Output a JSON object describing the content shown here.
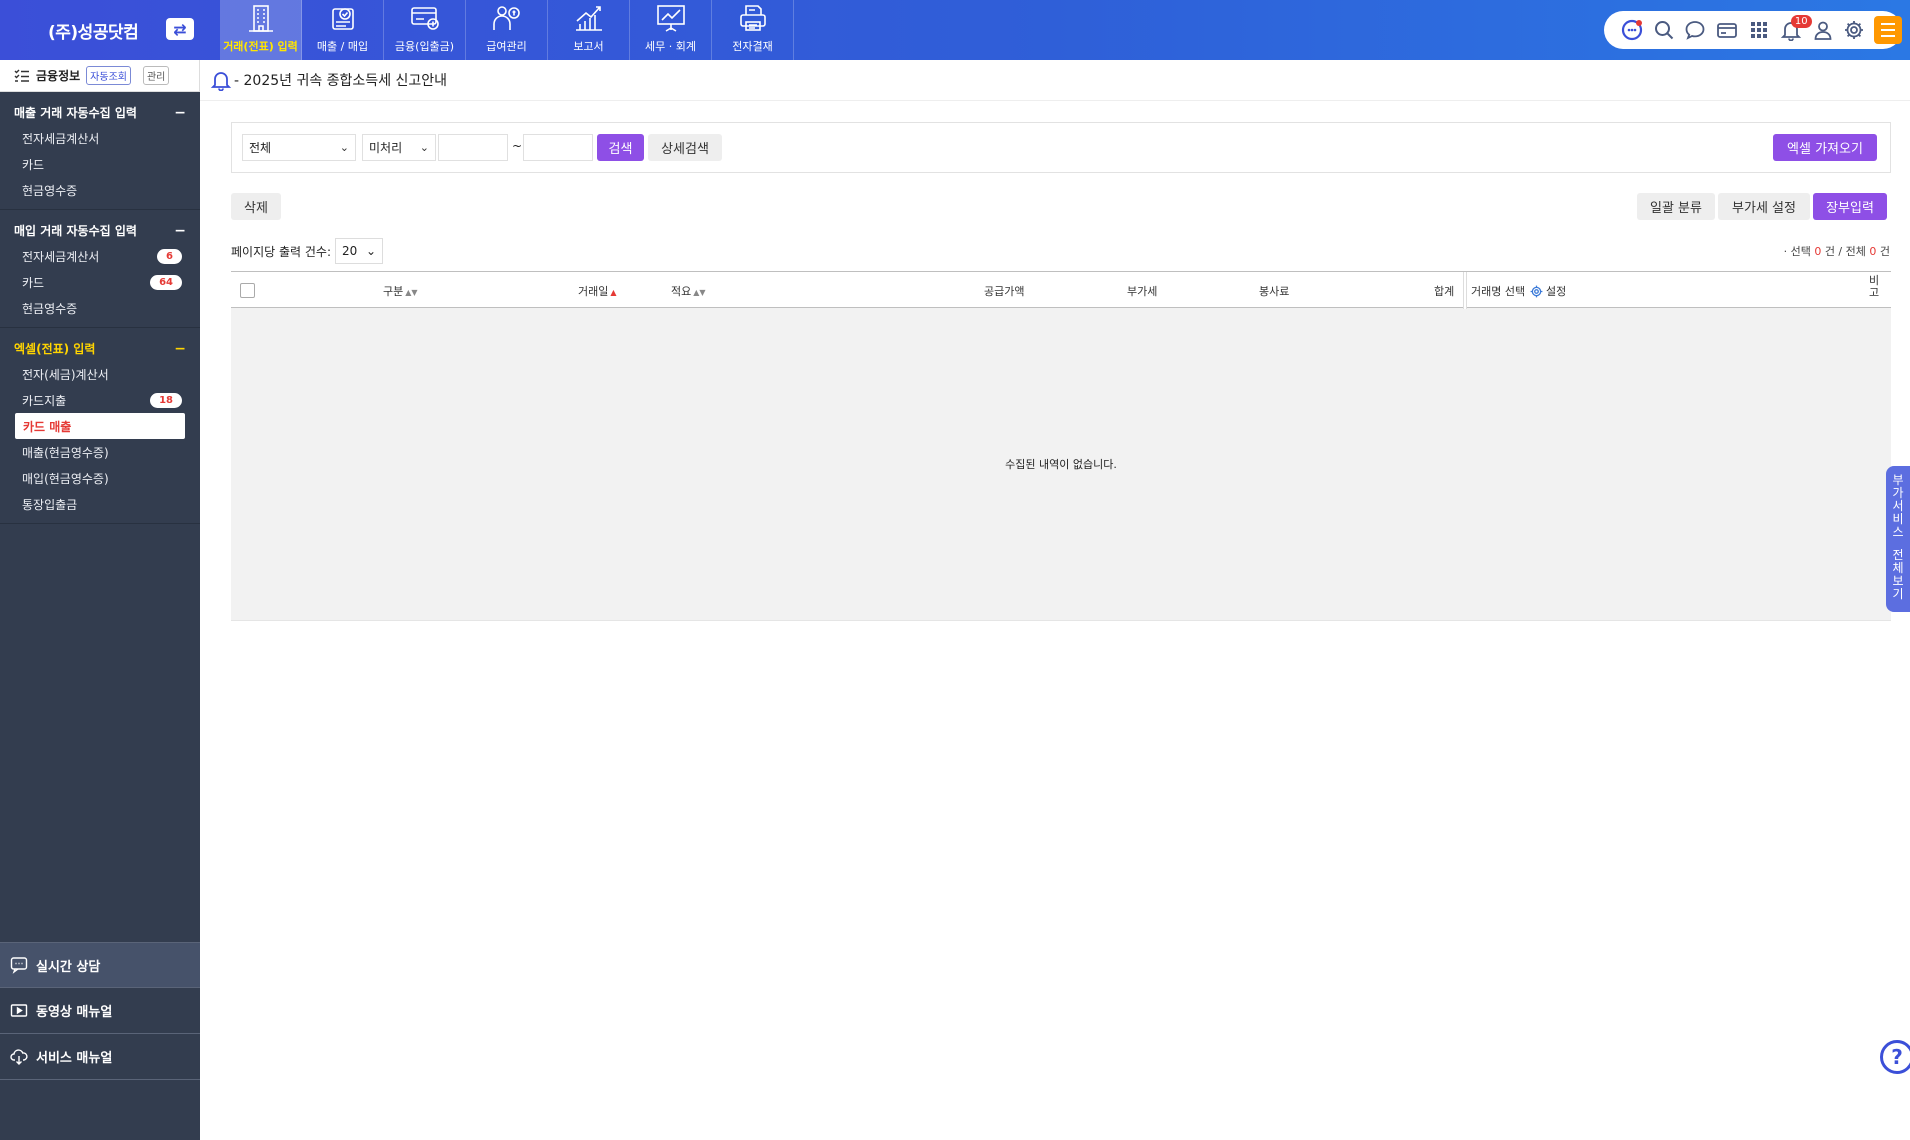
{
  "brand": {
    "name": "(주)성공닷컴",
    "switch_icon": "⇄"
  },
  "gnb": [
    {
      "label": "거래(전표) 입력",
      "icon": "building-icon",
      "active": true
    },
    {
      "label": "매출 / 매입",
      "icon": "receipt-check-icon"
    },
    {
      "label": "금융(입출금)",
      "icon": "card-coin-icon"
    },
    {
      "label": "급여관리",
      "icon": "payroll-icon"
    },
    {
      "label": "보고서",
      "icon": "chart-up-icon"
    },
    {
      "label": "세무 · 회계",
      "icon": "presentation-icon"
    },
    {
      "label": "전자결재",
      "icon": "printer-icon"
    }
  ],
  "tools": {
    "notification_count": "10"
  },
  "sidebar": {
    "head": {
      "title": "금융정보",
      "auto_chip": "자동조회",
      "manage_chip": "관리"
    },
    "groups": [
      {
        "title": "매출 거래 자동수집 입력",
        "items": [
          {
            "label": "전자세금계산서"
          },
          {
            "label": "카드"
          },
          {
            "label": "현금영수증"
          }
        ]
      },
      {
        "title": "매입 거래 자동수집 입력",
        "items": [
          {
            "label": "전자세금계산서",
            "badge": "6"
          },
          {
            "label": "카드",
            "badge": "64"
          },
          {
            "label": "현금영수증"
          }
        ]
      },
      {
        "title": "엑셀(전표) 입력",
        "items": [
          {
            "label": "전자(세금)계산서"
          },
          {
            "label": "카드지출",
            "badge": "18"
          },
          {
            "label": "카드 매출"
          },
          {
            "label": "매출(현금영수증)"
          },
          {
            "label": "매입(현금영수증)"
          },
          {
            "label": "통장입출금"
          }
        ]
      }
    ],
    "bottom": {
      "chat": "실시간 상담",
      "video": "동영상 매뉴얼",
      "service": "서비스 매뉴얼"
    }
  },
  "notice": {
    "text": "- 2025년 귀속 종합소득세 신고안내"
  },
  "search": {
    "type_value": "전체",
    "status_value": "미처리",
    "tilde": "~",
    "search_button": "검색",
    "detail_button": "상세검색",
    "excel_import_button": "엑셀 가져오기"
  },
  "actions": {
    "delete": "삭제",
    "bulk_classify": "일괄 분류",
    "vat_setting": "부가세 설정",
    "ledger_input": "장부입력"
  },
  "pager": {
    "label": "페이지당 출력 건수:",
    "value": "20"
  },
  "count": {
    "prefix": "· 선택",
    "selected": "0",
    "mid": "건 / 전체",
    "total": "0",
    "suffix": "건"
  },
  "table": {
    "headers": {
      "category": "구분",
      "date": "거래일",
      "summary": "적요",
      "supply": "공급가액",
      "vat": "부가세",
      "service_fee": "봉사료",
      "total": "합계",
      "partner_select": "거래명 선택",
      "setting": "설정",
      "note_1": "비",
      "note_2": "고"
    },
    "empty_message": "수집된 내역이 없습니다."
  },
  "side_tab": {
    "chars": [
      "부",
      "가",
      "서",
      "비",
      "스",
      " ",
      "전",
      "체",
      "보",
      "기"
    ]
  },
  "help": {
    "label": "?"
  }
}
